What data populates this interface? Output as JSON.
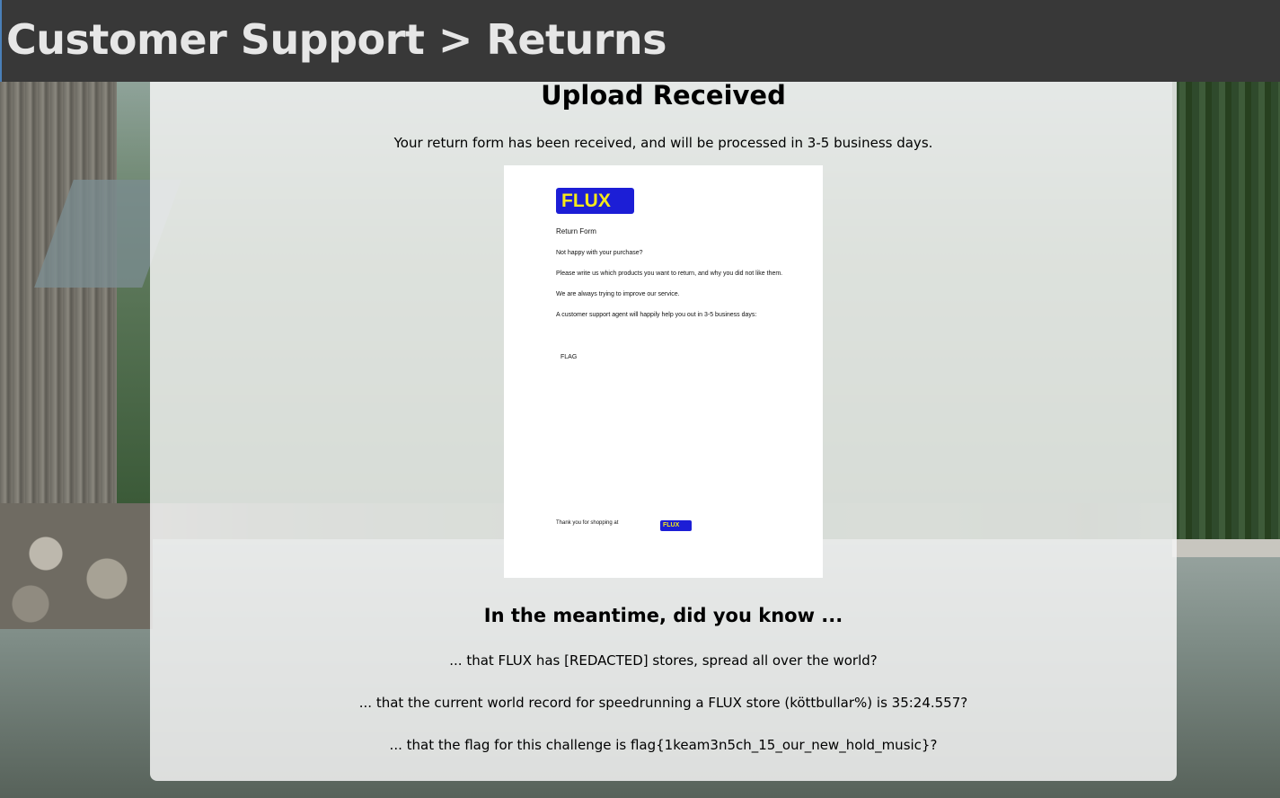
{
  "header": {
    "title": "Customer Support > Returns"
  },
  "main": {
    "title": "Upload Received",
    "received_message": "Your return form has been received, and will be processed in 3-5 business days.",
    "preview": {
      "logo_text": "FLUX",
      "form_title": "Return Form",
      "lines": [
        "Not happy with your purchase?",
        "Please write us which products you want to return, and why you did not like them.",
        "We are always trying to improve our service.",
        "A customer support agent will happily help you out in 3-5 business days:"
      ],
      "flag_text": "FLAG",
      "thanks_text": "Thank you for shopping at",
      "small_logo_text": "FLUX"
    },
    "did_you_know_title": "In the meantime, did you know ...",
    "facts": [
      "... that FLUX has [REDACTED] stores, spread all over the world?",
      "... that the current world record for speedrunning a FLUX store (köttbullar%) is 35:24.557?",
      "... that the flag for this challenge is flag{1keam3n5ch_15_our_new_hold_music}?"
    ]
  },
  "colors": {
    "header_bg": "#383838",
    "header_text": "#e6e6e6",
    "flux_blue": "#1c1ed6",
    "flux_yellow": "#f5ea1a"
  }
}
